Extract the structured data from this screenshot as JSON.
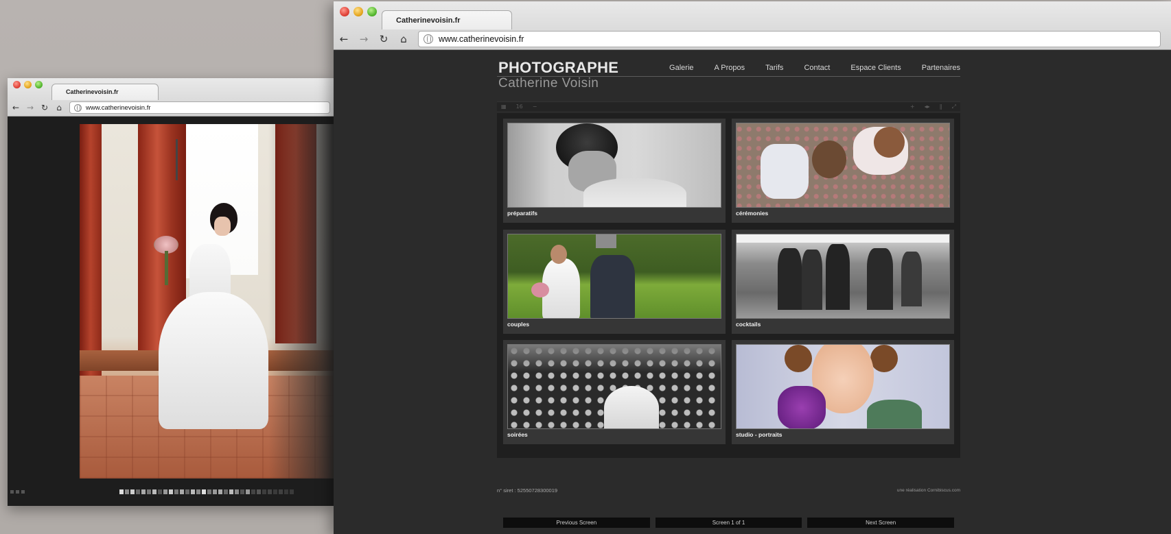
{
  "back_window": {
    "tab_title": "Catherinevoisin.fr",
    "url": "www.catherinevoisin.fr",
    "photo": "bride-with-bouquet"
  },
  "front_window": {
    "tab_title": "Catherinevoisin.fr",
    "url": "www.catherinevoisin.fr"
  },
  "site": {
    "logo_main": "PHOTOGRAPHE",
    "logo_sub": "Catherine Voisin",
    "nav": [
      "Galerie",
      "A Propos",
      "Tarifs",
      "Contact",
      "Espace Clients",
      "Partenaires"
    ],
    "toolbar": {
      "left_count": "16"
    },
    "gallery": [
      {
        "caption": "préparatifs"
      },
      {
        "caption": "cérémonies"
      },
      {
        "caption": "couples"
      },
      {
        "caption": "cocktails"
      },
      {
        "caption": "soirées"
      },
      {
        "caption": "studio - portraits"
      }
    ],
    "pager": {
      "prev": "Previous Screen",
      "status": "Screen 1 of 1",
      "next": "Next Screen"
    },
    "footer_left": "n° siret : 52550728300019",
    "footer_right": "une réalisation Cornibiscus.com"
  }
}
